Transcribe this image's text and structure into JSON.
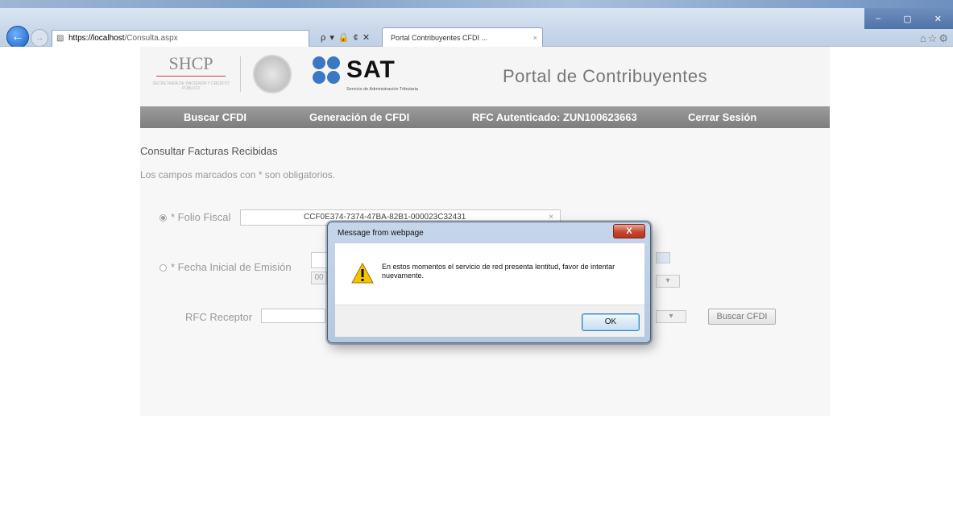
{
  "browser": {
    "window_controls": [
      "–",
      "▢",
      "✕"
    ],
    "address": {
      "protocol": "https://",
      "host": "localhost",
      "path": "/Consulta.aspx"
    },
    "address_tools": "ρ ▾ 🔒 ¢ ✕",
    "tab_title": "Portal Contribuyentes CFDI ...",
    "tab_close": "×"
  },
  "header": {
    "shcp_logo_text": "SHCP",
    "shcp_sub_text": "SECRETARÍA DE HACIENDA Y CRÉDITO PÚBLICO",
    "sat_logo_text": "SAT",
    "sat_sub_text": "Servicio de Administración Tributaria",
    "portal_title": "Portal de Contribuyentes"
  },
  "navbar": {
    "buscar": "Buscar CFDI",
    "generacion": "Generación de CFDI",
    "rfc_autenticado": "RFC Autenticado: ZUN100623663",
    "cerrar_sesion": "Cerrar Sesión"
  },
  "form": {
    "section_title": "Consultar Facturas Recibidas",
    "required_note": "Los campos marcados con * son obligatorios.",
    "folio_label": "* Folio Fiscal",
    "folio_value": "CCF0E374-7374-47BA-82B1-000023C32431",
    "folio_selected": true,
    "fecha_label": "* Fecha Inicial de Emisión",
    "rfc_label": "RFC Receptor",
    "buscar_button": "Buscar CFDI",
    "hour_select": "00"
  },
  "dialog": {
    "title": "Message from webpage",
    "close_label": "X",
    "message": "En estos momentos el servicio de red presenta lentitud, favor de intentar nuevamente.",
    "icon": "warning-icon",
    "ok_label": "OK"
  },
  "colors": {
    "navbar": "#8a8a8a",
    "sat_blue": "#3a78c6",
    "dialog_frame": "#b8cbe2",
    "close_red": "#c7452f"
  }
}
